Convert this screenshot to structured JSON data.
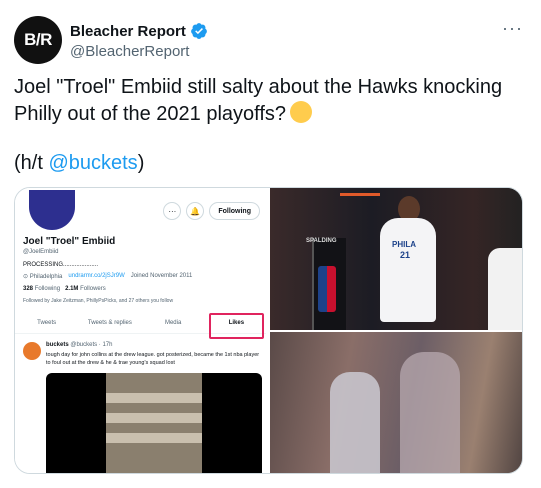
{
  "author": {
    "avatar_text": "B/R",
    "display_name": "Bleacher Report",
    "handle": "@BleacherReport"
  },
  "more_icon": "more-horizontal-icon",
  "tweet": {
    "text": "Joel \"Troel\" Embiid still salty about the Hawks knocking Philly out of the 2021 playoffs?",
    "emoji": "grinning-sweat-emoji",
    "ht_prefix": "(h/t ",
    "ht_mention": "@buckets",
    "ht_suffix": ")"
  },
  "embedded_profile": {
    "name": "Joel \"Troel\" Embiid",
    "handle": "@JoelEmbiid",
    "bio": "PROCESSING.....................",
    "location": "Philadelphia",
    "link": "undrarmr.co/2jSJr9W",
    "joined": "Joined November 2011",
    "following_count": "328",
    "following_label": "Following",
    "followers_count": "2.1M",
    "followers_label": "Followers",
    "followed_by": "Followed by Jake Zeitzman, PhillyPsPicks, and 27 others you follow",
    "follow_button": "Following",
    "tabs": [
      "Tweets",
      "Tweets & replies",
      "Media",
      "Likes"
    ],
    "liked_tweet": {
      "name": "buckets",
      "handle": "@buckets · 17h",
      "text": "tough day for john collins at the drew league. got posterized, became the 1st nba player to foul out at the drew & he & trae young's squad lost"
    }
  },
  "photos": {
    "jersey_name": "PHILA",
    "jersey_number": "21",
    "backboard_brand": "SPALDING"
  },
  "colors": {
    "accent": "#1d9bf0",
    "highlight_box": "#e0245e",
    "text": "#0f1419",
    "muted": "#536471"
  }
}
